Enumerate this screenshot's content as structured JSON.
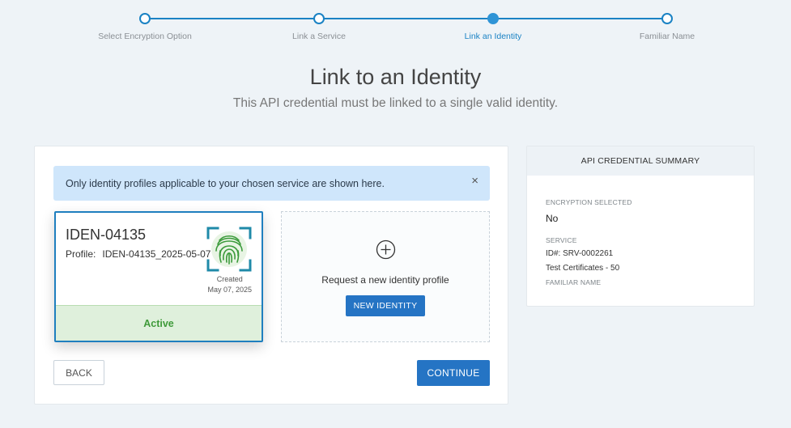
{
  "stepper": {
    "steps": [
      {
        "label": "Select Encryption Option",
        "state": "complete"
      },
      {
        "label": "Link a Service",
        "state": "complete"
      },
      {
        "label": "Link an Identity",
        "state": "active"
      },
      {
        "label": "Familiar Name",
        "state": "pending"
      }
    ]
  },
  "header": {
    "title": "Link to an Identity",
    "subtitle": "This API credential must be linked to a single valid identity."
  },
  "alert": {
    "message": "Only identity profiles applicable to your chosen service are shown here.",
    "close_glyph": "×"
  },
  "identity_card": {
    "id": "IDEN-04135",
    "profile_label": "Profile:",
    "profile_value": "IDEN-04135_2025-05-07",
    "created_label": "Created",
    "created_date": "May 07, 2025",
    "status": "Active",
    "icon": "fingerprint-icon"
  },
  "request_card": {
    "text": "Request a new identity profile",
    "button": "NEW IDENTITY",
    "icon": "plus-circle-icon"
  },
  "actions": {
    "back": "BACK",
    "continue": "CONTINUE"
  },
  "summary": {
    "title": "API CREDENTIAL SUMMARY",
    "encryption_label": "ENCRYPTION SELECTED",
    "encryption_value": "No",
    "service_label": "SERVICE",
    "service_id": "ID#: SRV-0002261",
    "service_name": "Test Certificates - 50",
    "familiar_name_label": "FAMILIAR NAME"
  },
  "colors": {
    "accent": "#2574c4",
    "step_line": "#1a82c4",
    "status_bg": "#dff0dc",
    "status_text": "#3f9a3a",
    "alert_bg": "#cfe6fb",
    "fingerprint": "#3a9a3a",
    "frame": "#1f8aa8"
  }
}
